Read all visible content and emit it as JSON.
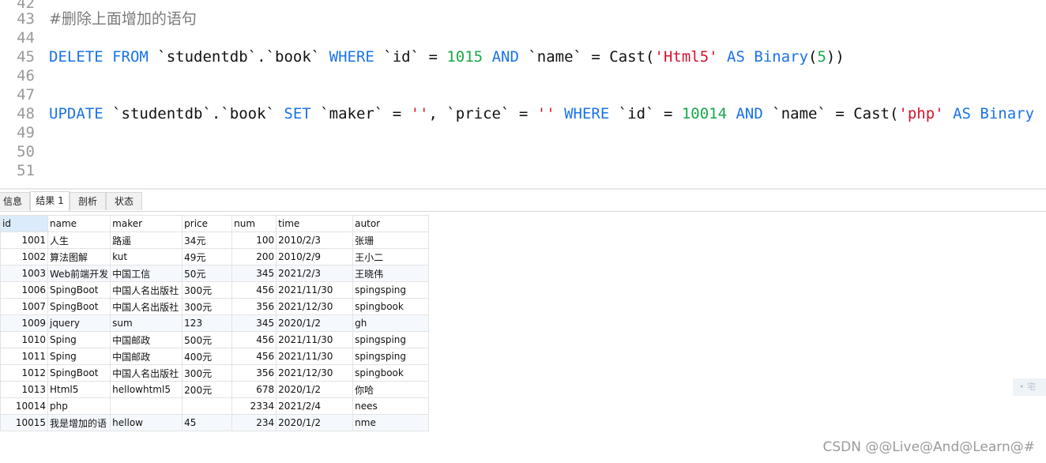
{
  "editor": {
    "lines": [
      {
        "num": "42",
        "tokens": []
      },
      {
        "num": "43",
        "tokens": [
          {
            "t": "cmt",
            "v": "#删除上面增加的语句"
          }
        ]
      },
      {
        "num": "44",
        "tokens": []
      },
      {
        "num": "45",
        "tokens": [
          {
            "t": "kw",
            "v": "DELETE"
          },
          {
            "t": "plain",
            "v": " "
          },
          {
            "t": "kw",
            "v": "FROM"
          },
          {
            "t": "plain",
            "v": " `studentdb`.`book` "
          },
          {
            "t": "kw",
            "v": "WHERE"
          },
          {
            "t": "plain",
            "v": " `id` = "
          },
          {
            "t": "num",
            "v": "1015"
          },
          {
            "t": "plain",
            "v": " "
          },
          {
            "t": "kw",
            "v": "AND"
          },
          {
            "t": "plain",
            "v": " `name` = Cast("
          },
          {
            "t": "str",
            "v": "'Html5'"
          },
          {
            "t": "plain",
            "v": " "
          },
          {
            "t": "kw",
            "v": "AS"
          },
          {
            "t": "plain",
            "v": " "
          },
          {
            "t": "kw",
            "v": "Binary"
          },
          {
            "t": "plain",
            "v": "("
          },
          {
            "t": "num",
            "v": "5"
          },
          {
            "t": "plain",
            "v": "))"
          }
        ]
      },
      {
        "num": "46",
        "tokens": []
      },
      {
        "num": "47",
        "tokens": []
      },
      {
        "num": "48",
        "tokens": [
          {
            "t": "kw",
            "v": "UPDATE"
          },
          {
            "t": "plain",
            "v": " `studentdb`.`book` "
          },
          {
            "t": "kw",
            "v": "SET"
          },
          {
            "t": "plain",
            "v": " `maker` = "
          },
          {
            "t": "str",
            "v": "''"
          },
          {
            "t": "plain",
            "v": ", `price` = "
          },
          {
            "t": "str",
            "v": "''"
          },
          {
            "t": "plain",
            "v": " "
          },
          {
            "t": "kw",
            "v": "WHERE"
          },
          {
            "t": "plain",
            "v": " `id` = "
          },
          {
            "t": "num",
            "v": "10014"
          },
          {
            "t": "plain",
            "v": " "
          },
          {
            "t": "kw",
            "v": "AND"
          },
          {
            "t": "plain",
            "v": " `name` = Cast("
          },
          {
            "t": "str",
            "v": "'php'"
          },
          {
            "t": "plain",
            "v": " "
          },
          {
            "t": "kw",
            "v": "AS"
          },
          {
            "t": "plain",
            "v": " "
          },
          {
            "t": "kw",
            "v": "Binary"
          }
        ]
      },
      {
        "num": "49",
        "tokens": []
      },
      {
        "num": "50",
        "tokens": []
      },
      {
        "num": "51",
        "tokens": []
      }
    ]
  },
  "tabs": [
    {
      "label": "信息",
      "active": false
    },
    {
      "label": "结果 1",
      "active": true
    },
    {
      "label": "剖析",
      "active": false
    },
    {
      "label": "状态",
      "active": false
    }
  ],
  "results": {
    "columns": [
      "id",
      "name",
      "maker",
      "price",
      "num",
      "time",
      "autor"
    ],
    "rows": [
      [
        "1001",
        "人生",
        "路遥",
        "34元",
        "100",
        "2010/2/3",
        "张珊"
      ],
      [
        "1002",
        "算法图解",
        "kut",
        "49元",
        "200",
        "2010/2/9",
        "王小二"
      ],
      [
        "1003",
        "Web前端开发",
        "中国工信",
        "50元",
        "345",
        "2021/2/3",
        "王晓伟"
      ],
      [
        "1006",
        "SpingBoot",
        "中国人名出版社",
        "300元",
        "456",
        "2021/11/30",
        "spingsping"
      ],
      [
        "1007",
        "SpingBoot",
        "中国人名出版社",
        "300元",
        "356",
        "2021/12/30",
        "spingbook"
      ],
      [
        "1009",
        "jquery",
        "sum",
        "123",
        "345",
        "2020/1/2",
        "gh"
      ],
      [
        "1010",
        "Sping",
        "中国邮政",
        "500元",
        "456",
        "2021/11/30",
        "spingsping"
      ],
      [
        "1011",
        "Sping",
        "中国邮政",
        "400元",
        "456",
        "2021/11/30",
        "spingsping"
      ],
      [
        "1012",
        "SpingBoot",
        "中国人名出版社",
        "300元",
        "356",
        "2021/12/30",
        "spingbook"
      ],
      [
        "1013",
        "Html5",
        "hellowhtml5",
        "200元",
        "678",
        "2020/1/2",
        "你哈"
      ],
      [
        "10014",
        "php",
        "",
        "",
        "2334",
        "2021/2/4",
        "nees"
      ],
      [
        "10015",
        "我是增加的语",
        "hellow",
        "45",
        "234",
        "2020/1/2",
        "nme"
      ]
    ]
  },
  "side_chip": "•  宅",
  "watermark": "CSDN @@Live@And@Learn@#",
  "colors": {
    "keyword": "#1a73e8",
    "number": "#18a84b",
    "string": "#d6122b",
    "comment": "#7a7a7a"
  }
}
